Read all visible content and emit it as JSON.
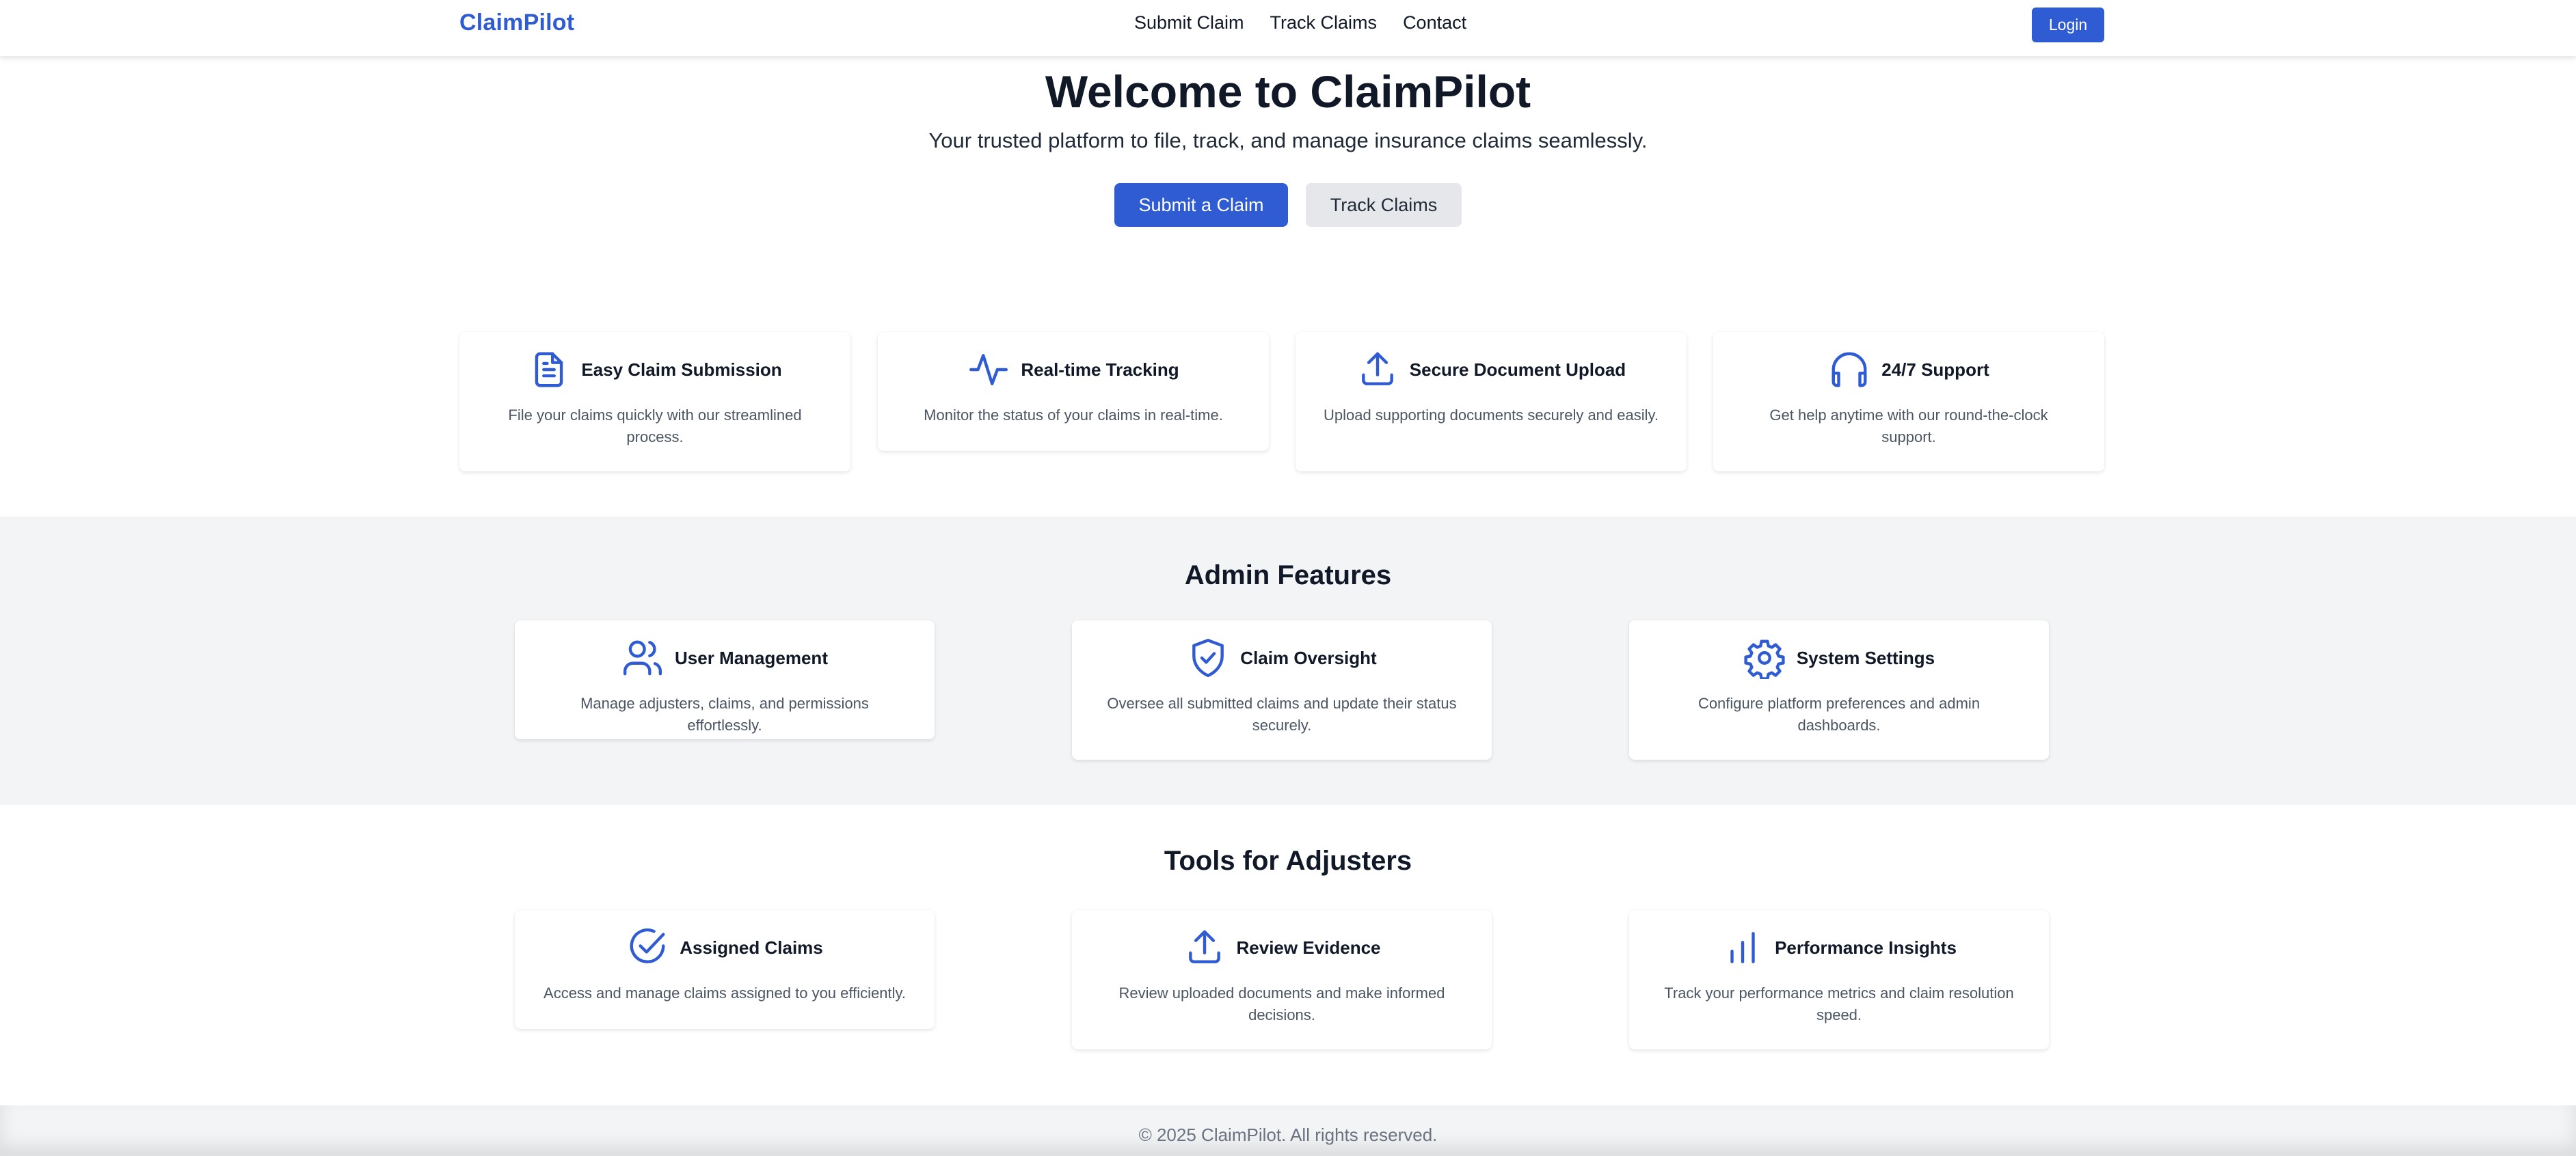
{
  "brand": "ClaimPilot",
  "nav": {
    "links": [
      "Submit Claim",
      "Track Claims",
      "Contact"
    ],
    "login_label": "Login"
  },
  "hero": {
    "title": "Welcome to ClaimPilot",
    "subtitle": "Your trusted platform to file, track, and manage insurance claims seamlessly.",
    "primary_button": "Submit a Claim",
    "secondary_button": "Track Claims"
  },
  "features": [
    {
      "icon": "document-icon",
      "title": "Easy Claim Submission",
      "desc": "File your claims quickly with our streamlined process."
    },
    {
      "icon": "activity-icon",
      "title": "Real-time Tracking",
      "desc": "Monitor the status of your claims in real-time."
    },
    {
      "icon": "upload-icon",
      "title": "Secure Document Upload",
      "desc": "Upload supporting documents securely and easily."
    },
    {
      "icon": "headphones-icon",
      "title": "24/7 Support",
      "desc": "Get help anytime with our round-the-clock support."
    }
  ],
  "admin": {
    "title": "Admin Features",
    "cards": [
      {
        "icon": "users-icon",
        "title": "User Management",
        "desc": "Manage adjusters, claims, and permissions effortlessly."
      },
      {
        "icon": "shield-check-icon",
        "title": "Claim Oversight",
        "desc": "Oversee all submitted claims and update their status securely."
      },
      {
        "icon": "gear-icon",
        "title": "System Settings",
        "desc": "Configure platform preferences and admin dashboards."
      }
    ]
  },
  "adjusters": {
    "title": "Tools for Adjusters",
    "cards": [
      {
        "icon": "check-circle-icon",
        "title": "Assigned Claims",
        "desc": "Access and manage claims assigned to you efficiently."
      },
      {
        "icon": "upload-icon",
        "title": "Review Evidence",
        "desc": "Review uploaded documents and make informed decisions."
      },
      {
        "icon": "bar-chart-icon",
        "title": "Performance Insights",
        "desc": "Track your performance metrics and claim resolution speed."
      }
    ]
  },
  "footer": "© 2025 ClaimPilot. All rights reserved.",
  "colors": {
    "accent": "#2f5bd3",
    "section_bg": "#f3f4f6",
    "secondary_button_bg": "#e5e7eb"
  }
}
